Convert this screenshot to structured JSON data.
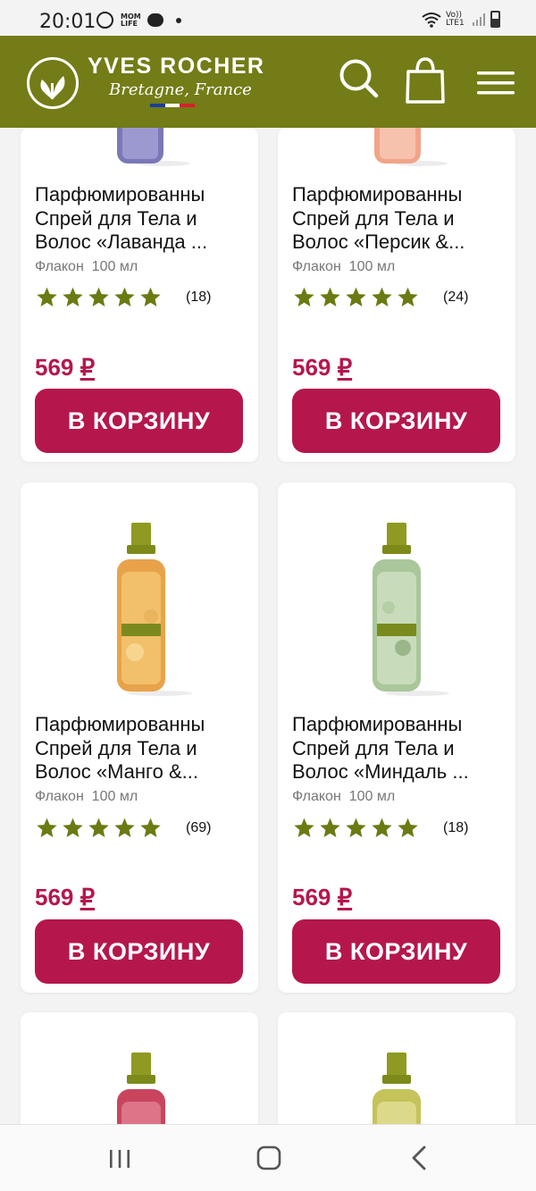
{
  "status_bar": {
    "time": "20:01",
    "app_badge": "MOM LIFE",
    "network": "Vo)) LTE1",
    "icons": [
      "whatsapp-icon",
      "mom-life-icon",
      "chat-icon",
      "dot-icon",
      "wifi-icon",
      "lte-icon",
      "signal-icon",
      "battery-icon"
    ]
  },
  "header": {
    "brand": "YVES ROCHER",
    "subtitle": "Bretagne, France",
    "background": "#737c16",
    "icons": [
      "logo-leaf-icon",
      "search-icon",
      "shopping-bag-icon",
      "hamburger-menu-icon"
    ]
  },
  "products": [
    {
      "name_lines": [
        "Парфюмированны",
        "Спрей для Тела и",
        "Волос «Лаванда ..."
      ],
      "volume_label": "Флакон",
      "volume": "100 мл",
      "rating": 5,
      "reviews": "(18)",
      "price": "569",
      "currency": "₽",
      "cart_label": "В КОРЗИНУ"
    },
    {
      "name_lines": [
        "Парфюмированны",
        "Спрей для Тела и",
        "Волос «Персик &..."
      ],
      "volume_label": "Флакон",
      "volume": "100 мл",
      "rating": 5,
      "reviews": "(24)",
      "price": "569",
      "currency": "₽",
      "cart_label": "В КОРЗИНУ"
    },
    {
      "name_lines": [
        "Парфюмированны",
        "Спрей для Тела и",
        "Волос «Манго &..."
      ],
      "volume_label": "Флакон",
      "volume": "100 мл",
      "rating": 5,
      "reviews": "(69)",
      "price": "569",
      "currency": "₽",
      "cart_label": "В КОРЗИНУ"
    },
    {
      "name_lines": [
        "Парфюмированны",
        "Спрей для Тела и",
        "Волос «Миндаль ..."
      ],
      "volume_label": "Флакон",
      "volume": "100 мл",
      "rating": 5,
      "reviews": "(18)",
      "price": "569",
      "currency": "₽",
      "cart_label": "В КОРЗИНУ"
    }
  ],
  "colors": {
    "brand_green": "#737c16",
    "star": "#6b7a12",
    "price": "#b5174d",
    "button": "#b5174d"
  },
  "navbar": {
    "icons": [
      "recent-apps-icon",
      "home-icon",
      "back-icon"
    ]
  }
}
